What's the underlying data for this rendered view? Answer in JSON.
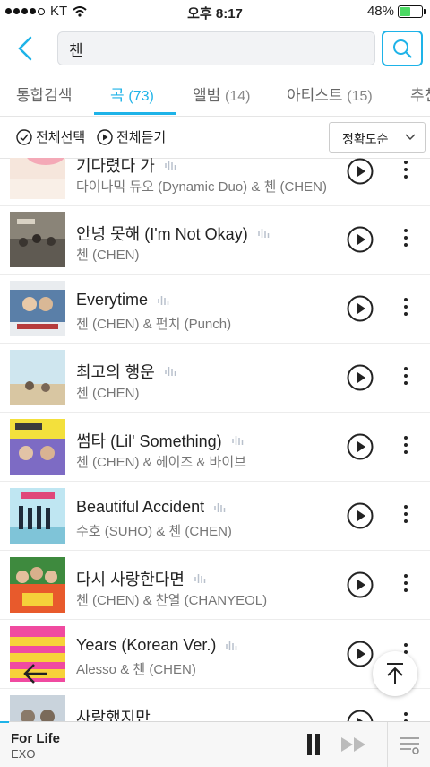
{
  "status_bar": {
    "carrier": "KT",
    "time": "오후 8:17",
    "battery": "48%",
    "battery_level": 0.48,
    "battery_color": "#4cd964"
  },
  "search": {
    "query": "첸"
  },
  "accent_color": "#1eb3e8",
  "tabs": [
    {
      "label": "통합검색",
      "count": ""
    },
    {
      "label": "곡",
      "count": "(73)"
    },
    {
      "label": "앨범",
      "count": "(14)"
    },
    {
      "label": "아티스트",
      "count": "(15)"
    },
    {
      "label": "추천",
      "count": ""
    }
  ],
  "toolbar": {
    "select_all": "전체선택",
    "play_all": "전체듣기",
    "sort": "정확도순"
  },
  "songs": [
    {
      "title": "기다렸다 가",
      "artist": "다이나믹 듀오 (Dynamic Duo) & 첸 (CHEN)"
    },
    {
      "title": "안녕 못해 (I'm Not Okay)",
      "artist": "첸 (CHEN)"
    },
    {
      "title": "Everytime",
      "artist": "첸 (CHEN) & 펀치 (Punch)"
    },
    {
      "title": "최고의 행운",
      "artist": "첸 (CHEN)"
    },
    {
      "title": "썸타 (Lil' Something)",
      "artist": "첸 (CHEN) & 헤이즈 & 바이브"
    },
    {
      "title": "Beautiful Accident",
      "artist": "수호 (SUHO) & 첸 (CHEN)"
    },
    {
      "title": "다시 사랑한다면",
      "artist": "첸 (CHEN) & 찬열 (CHANYEOL)"
    },
    {
      "title": "Years (Korean Ver.)",
      "artist": "Alesso & 첸 (CHEN)"
    },
    {
      "title": "사랑했지만",
      "artist": ""
    }
  ],
  "player": {
    "track": "For Life",
    "artist": "EXO",
    "progress": 0.02
  }
}
